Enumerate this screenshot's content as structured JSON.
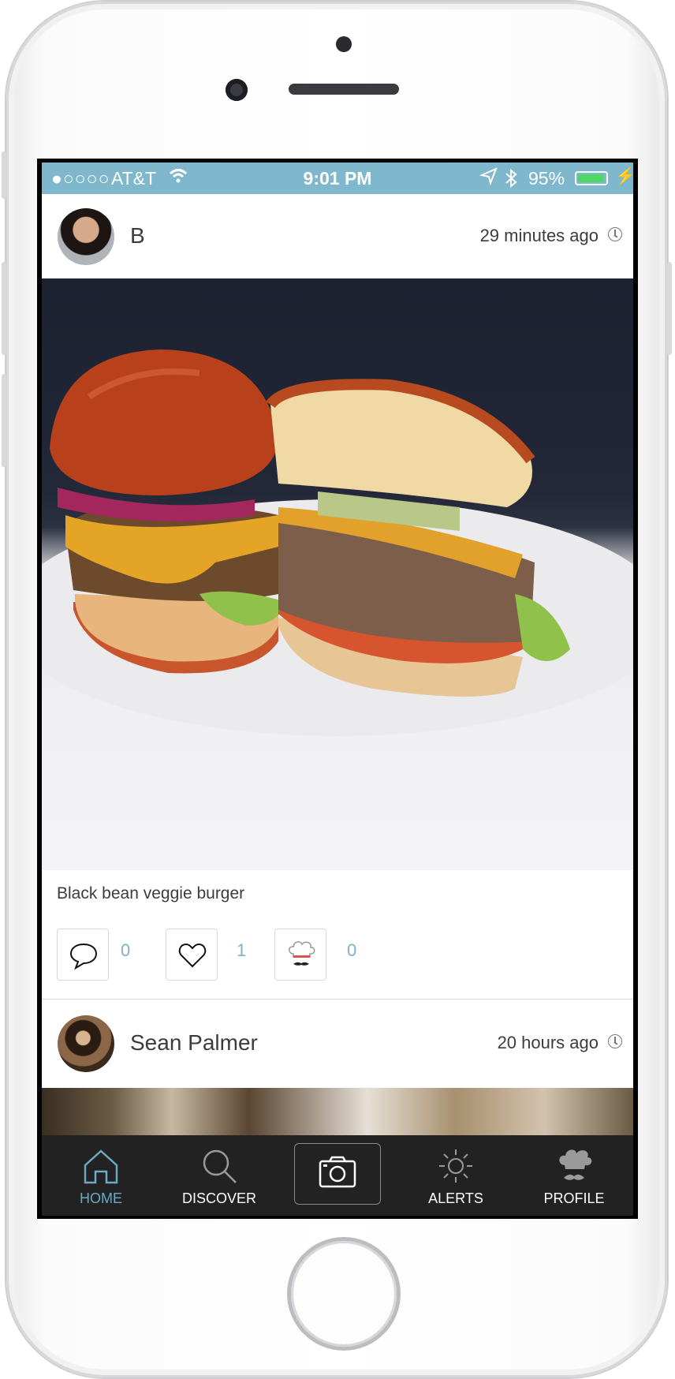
{
  "status_bar": {
    "signal": "●○○○○",
    "carrier": "AT&T",
    "time": "9:01 PM",
    "battery_percent": "95%",
    "battery_level": 0.95,
    "colors": {
      "background": "#7fb8cc",
      "battery": "#4cd964"
    }
  },
  "feed": {
    "posts": [
      {
        "user": "B",
        "time_ago": "29 minutes ago",
        "caption": "Black bean veggie burger",
        "comments": "0",
        "likes": "1",
        "chef_count": "0"
      },
      {
        "user": "Sean Palmer",
        "time_ago": "20 hours ago"
      }
    ]
  },
  "tab_bar": {
    "home": "HOME",
    "discover": "DISCOVER",
    "alerts": "ALERTS",
    "profile": "PROFILE",
    "active_color": "#6aaac4",
    "background": "#222222"
  },
  "icons": [
    "comment-icon",
    "heart-icon",
    "chef-hat-icon",
    "home-icon",
    "search-icon",
    "camera-icon",
    "sun-icon",
    "profile-chef-icon",
    "clock-icon",
    "wifi-icon",
    "location-icon",
    "bluetooth-icon",
    "battery-icon"
  ]
}
